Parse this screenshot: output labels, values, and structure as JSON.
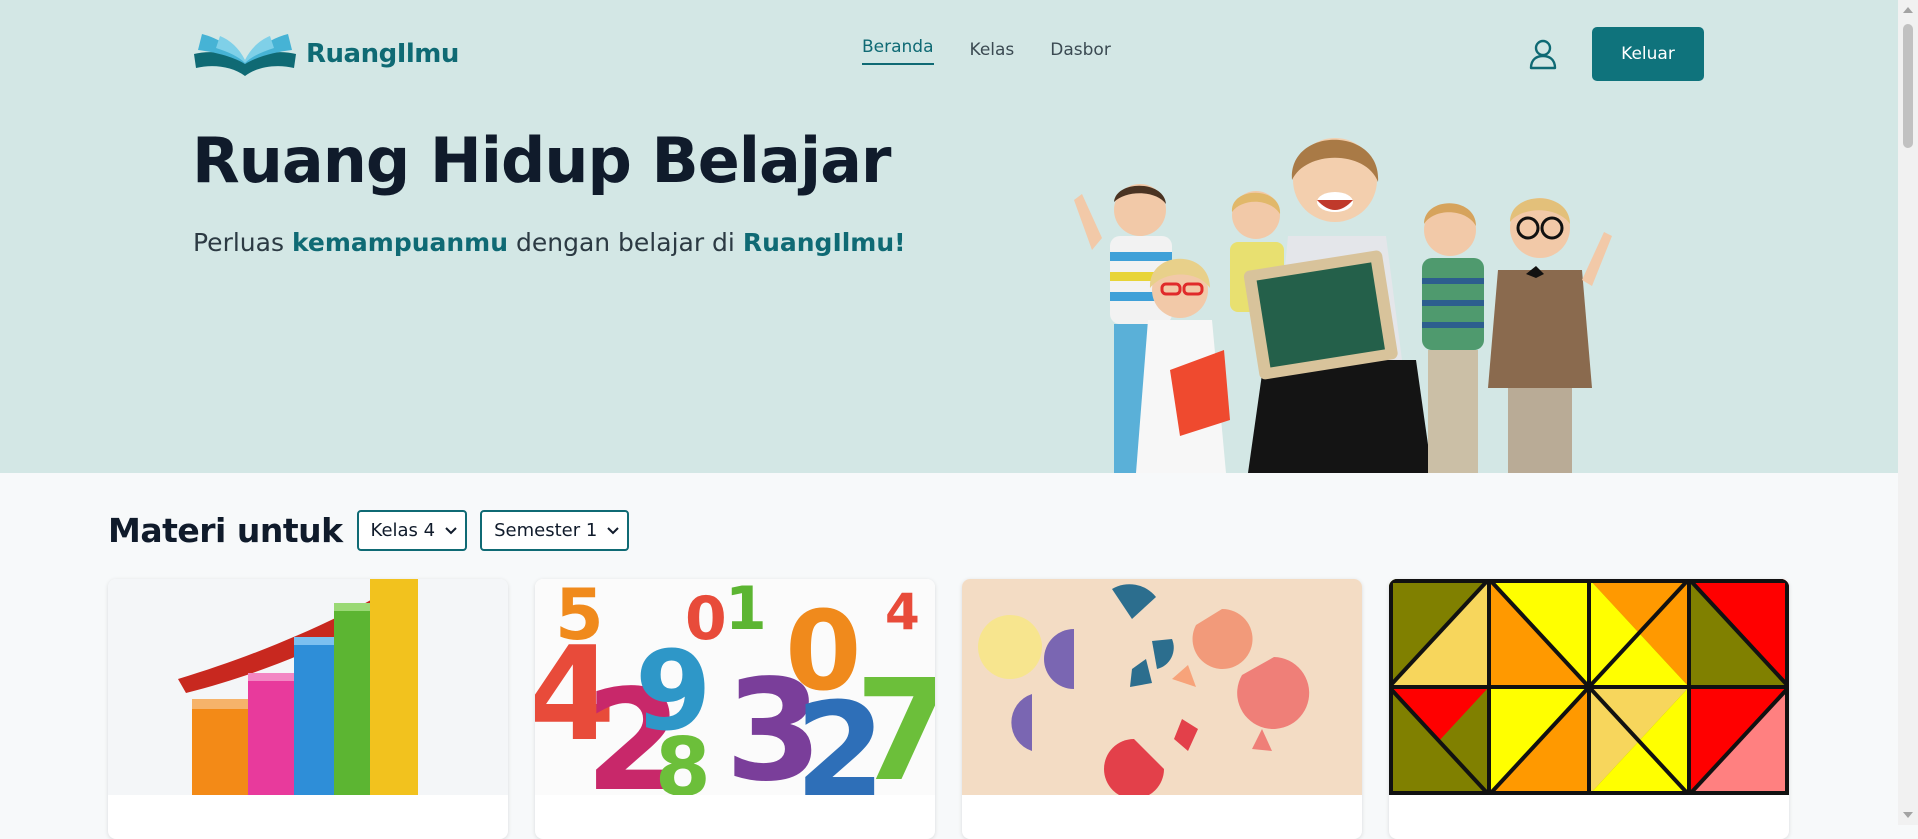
{
  "header": {
    "brand": "RuangIlmu",
    "nav": [
      {
        "label": "Beranda",
        "active": true
      },
      {
        "label": "Kelas",
        "active": false
      },
      {
        "label": "Dasbor",
        "active": false
      }
    ],
    "logout_label": "Keluar"
  },
  "hero": {
    "title": "Ruang Hidup Belajar",
    "sub_prefix": "Perluas ",
    "sub_highlight1": "kemampuanmu",
    "sub_middle": " dengan belajar di ",
    "sub_highlight2": "RuangIlmu!"
  },
  "materials": {
    "heading": "Materi untuk",
    "grade_select": "Kelas 4",
    "semester_select": "Semester 1",
    "cards": [
      {
        "image": "bar-chart-3d"
      },
      {
        "image": "colorful-numbers"
      },
      {
        "image": "fraction-pieces"
      },
      {
        "image": "triangle-pattern"
      }
    ]
  },
  "colors": {
    "accent": "#0f6a74",
    "hero_bg": "#d3e7e5",
    "button_bg": "#0f737c"
  }
}
